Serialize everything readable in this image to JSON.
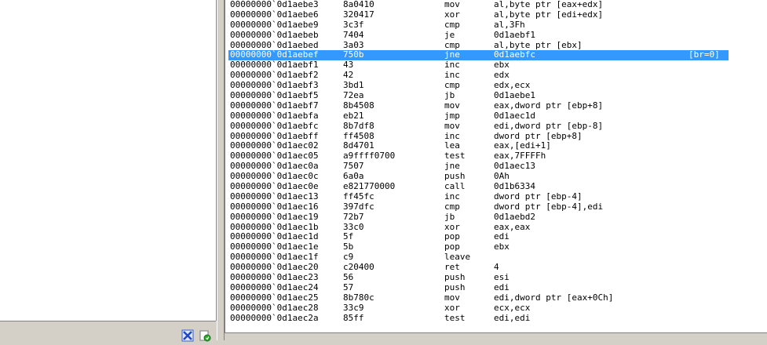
{
  "status_icons": [
    "window-tile-icon",
    "refresh-icon"
  ],
  "selected_note": "[br=0]",
  "lines": [
    {
      "addr": "00000000`0d1aebe3",
      "bytes": "8a0410",
      "mnem": "mov",
      "ops": "al,byte ptr [eax+edx]"
    },
    {
      "addr": "00000000`0d1aebe6",
      "bytes": "320417",
      "mnem": "xor",
      "ops": "al,byte ptr [edi+edx]"
    },
    {
      "addr": "00000000`0d1aebe9",
      "bytes": "3c3f",
      "mnem": "cmp",
      "ops": "al,3Fh"
    },
    {
      "addr": "00000000`0d1aebeb",
      "bytes": "7404",
      "mnem": "je",
      "ops": "0d1aebf1"
    },
    {
      "addr": "00000000`0d1aebed",
      "bytes": "3a03",
      "mnem": "cmp",
      "ops": "al,byte ptr [ebx]"
    },
    {
      "addr": "00000000`0d1aebef",
      "bytes": "750b",
      "mnem": "jne",
      "ops": "0d1aebfc",
      "selected": true
    },
    {
      "addr": "00000000`0d1aebf1",
      "bytes": "43",
      "mnem": "inc",
      "ops": "ebx"
    },
    {
      "addr": "00000000`0d1aebf2",
      "bytes": "42",
      "mnem": "inc",
      "ops": "edx"
    },
    {
      "addr": "00000000`0d1aebf3",
      "bytes": "3bd1",
      "mnem": "cmp",
      "ops": "edx,ecx"
    },
    {
      "addr": "00000000`0d1aebf5",
      "bytes": "72ea",
      "mnem": "jb",
      "ops": "0d1aebe1"
    },
    {
      "addr": "00000000`0d1aebf7",
      "bytes": "8b4508",
      "mnem": "mov",
      "ops": "eax,dword ptr [ebp+8]"
    },
    {
      "addr": "00000000`0d1aebfa",
      "bytes": "eb21",
      "mnem": "jmp",
      "ops": "0d1aec1d"
    },
    {
      "addr": "00000000`0d1aebfc",
      "bytes": "8b7df8",
      "mnem": "mov",
      "ops": "edi,dword ptr [ebp-8]"
    },
    {
      "addr": "00000000`0d1aebff",
      "bytes": "ff4508",
      "mnem": "inc",
      "ops": "dword ptr [ebp+8]"
    },
    {
      "addr": "00000000`0d1aec02",
      "bytes": "8d4701",
      "mnem": "lea",
      "ops": "eax,[edi+1]"
    },
    {
      "addr": "00000000`0d1aec05",
      "bytes": "a9ffff0700",
      "mnem": "test",
      "ops": "eax,7FFFFh"
    },
    {
      "addr": "00000000`0d1aec0a",
      "bytes": "7507",
      "mnem": "jne",
      "ops": "0d1aec13"
    },
    {
      "addr": "00000000`0d1aec0c",
      "bytes": "6a0a",
      "mnem": "push",
      "ops": "0Ah"
    },
    {
      "addr": "00000000`0d1aec0e",
      "bytes": "e821770000",
      "mnem": "call",
      "ops": "0d1b6334"
    },
    {
      "addr": "00000000`0d1aec13",
      "bytes": "ff45fc",
      "mnem": "inc",
      "ops": "dword ptr [ebp-4]"
    },
    {
      "addr": "00000000`0d1aec16",
      "bytes": "397dfc",
      "mnem": "cmp",
      "ops": "dword ptr [ebp-4],edi"
    },
    {
      "addr": "00000000`0d1aec19",
      "bytes": "72b7",
      "mnem": "jb",
      "ops": "0d1aebd2"
    },
    {
      "addr": "00000000`0d1aec1b",
      "bytes": "33c0",
      "mnem": "xor",
      "ops": "eax,eax"
    },
    {
      "addr": "00000000`0d1aec1d",
      "bytes": "5f",
      "mnem": "pop",
      "ops": "edi"
    },
    {
      "addr": "00000000`0d1aec1e",
      "bytes": "5b",
      "mnem": "pop",
      "ops": "ebx"
    },
    {
      "addr": "00000000`0d1aec1f",
      "bytes": "c9",
      "mnem": "leave",
      "ops": ""
    },
    {
      "addr": "00000000`0d1aec20",
      "bytes": "c20400",
      "mnem": "ret",
      "ops": "4"
    },
    {
      "addr": "00000000`0d1aec23",
      "bytes": "56",
      "mnem": "push",
      "ops": "esi"
    },
    {
      "addr": "00000000`0d1aec24",
      "bytes": "57",
      "mnem": "push",
      "ops": "edi"
    },
    {
      "addr": "00000000`0d1aec25",
      "bytes": "8b780c",
      "mnem": "mov",
      "ops": "edi,dword ptr [eax+0Ch]"
    },
    {
      "addr": "00000000`0d1aec28",
      "bytes": "33c9",
      "mnem": "xor",
      "ops": "ecx,ecx"
    },
    {
      "addr": "00000000`0d1aec2a",
      "bytes": "85ff",
      "mnem": "test",
      "ops": "edi,edi"
    }
  ]
}
